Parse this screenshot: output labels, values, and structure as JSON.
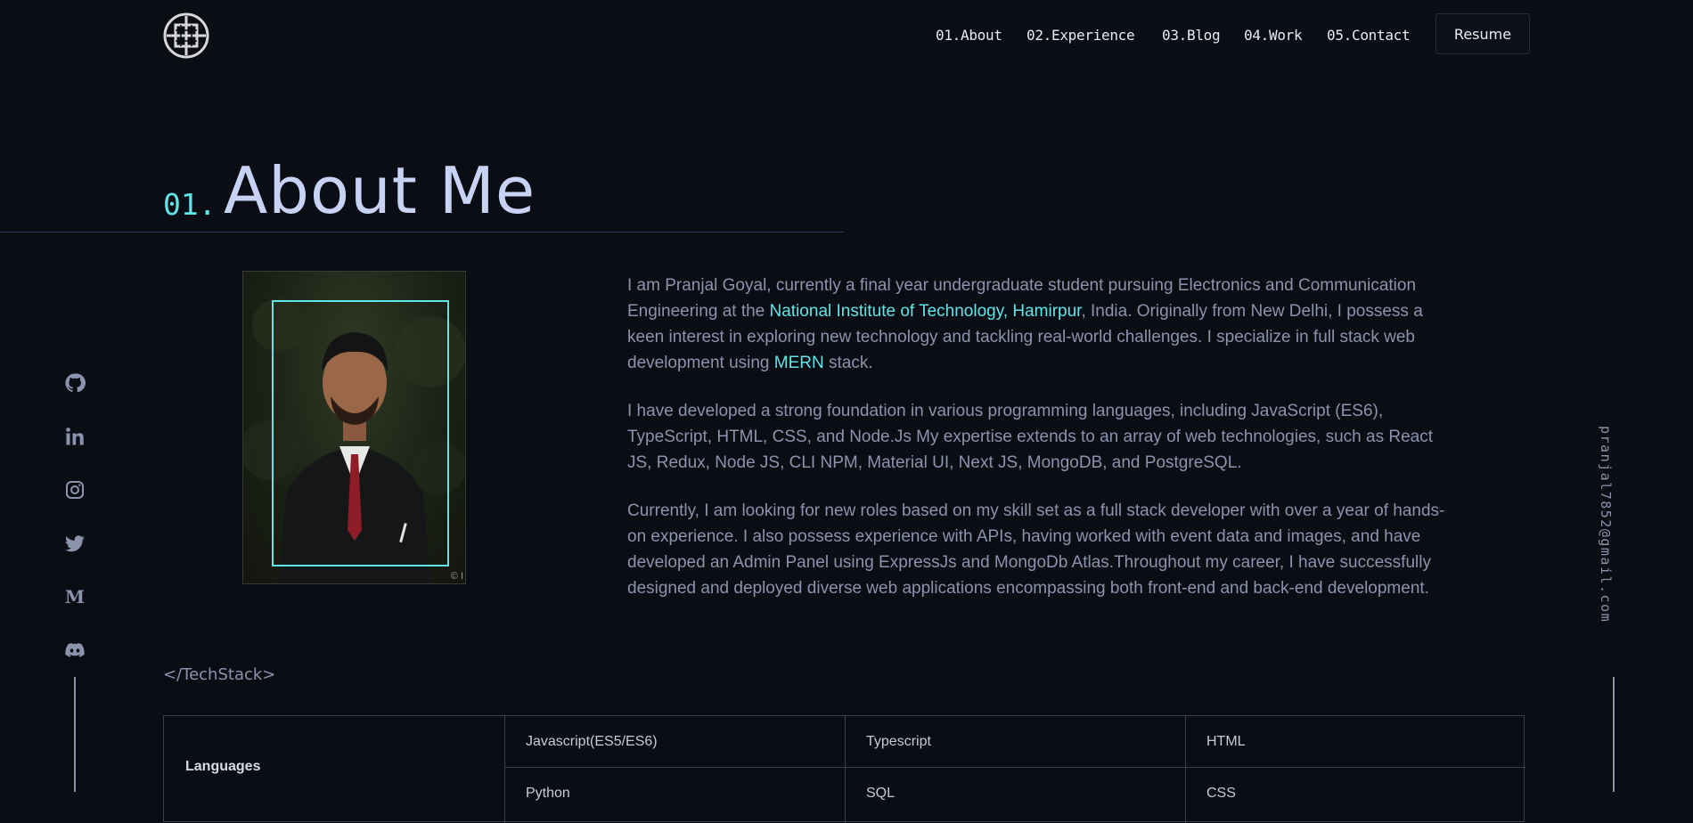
{
  "header": {
    "logo_icon": "celtic-knot-logo-icon",
    "nav": [
      {
        "label": "01.About"
      },
      {
        "label": "02.Experience"
      },
      {
        "label": "03.Blog"
      },
      {
        "label": "04.Work"
      },
      {
        "label": "05.Contact"
      }
    ],
    "resume_label": "Resume"
  },
  "about": {
    "number": "01.",
    "title": "About Me",
    "photo_credit": "© I",
    "p1": {
      "a": "I am Pranjal Goyal, currently a final year undergraduate student pursuing Electronics and Communication Engineering at the ",
      "link1": "National Institute of Technology, Hamirpur",
      "b": ", India. Originally from New Delhi, I possess a keen interest in exploring new technology and tackling real-world challenges. I specialize in full stack web development using ",
      "link2": "MERN",
      "c": " stack."
    },
    "p2": "I have developed a strong foundation in various programming languages, including JavaScript (ES6), TypeScript, HTML, CSS, and Node.Js My expertise extends to an array of web technologies, such as React JS, Redux, Node JS, CLI NPM, Material UI, Next JS, MongoDB, and PostgreSQL.",
    "p3": "Currently, I am looking for new roles based on my skill set as a full stack developer with over a year of hands-on experience. I also possess experience with APIs, having worked with event data and images, and have developed an Admin Panel using ExpressJs and MongoDb Atlas.Throughout my career, I have successfully designed and deployed diverse web applications encompassing both front-end and back-end development."
  },
  "socials": [
    "github-icon",
    "linkedin-icon",
    "instagram-icon",
    "twitter-icon",
    "medium-icon",
    "discord-icon"
  ],
  "email": "pranjal7852@gmail.com",
  "techstack": {
    "title": "</TechStack>",
    "category": "Languages",
    "row1": [
      "Javascript(ES5/ES6)",
      "Typescript",
      "HTML"
    ],
    "row2": [
      "Python",
      "SQL",
      "CSS"
    ]
  },
  "colors": {
    "background": "#0a0d14",
    "accent": "#5ee6e9",
    "heading": "#c7d2f5",
    "text": "#8b93ad"
  }
}
